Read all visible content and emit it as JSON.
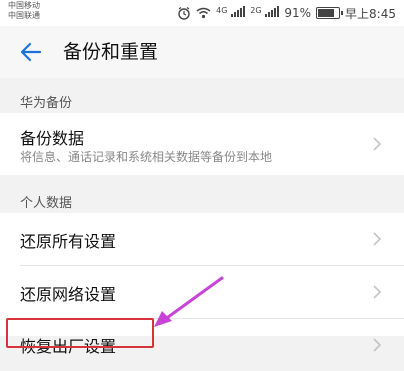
{
  "status_bar": {
    "carrier_1": "中国移动",
    "carrier_2": "中国联通",
    "network_1": "4G",
    "network_2": "2G",
    "battery": "91%",
    "battery_level": 0.91,
    "time": "早上8:45"
  },
  "header": {
    "title": "备份和重置"
  },
  "sections": [
    {
      "header": "华为备份",
      "items": [
        {
          "title": "备份数据",
          "subtitle": "将信息、通话记录和系统相关数据等备份到本地"
        }
      ]
    },
    {
      "header": "个人数据",
      "items": [
        {
          "title": "还原所有设置"
        },
        {
          "title": "还原网络设置"
        },
        {
          "title": "恢复出厂设置"
        }
      ]
    }
  ],
  "colors": {
    "accent": "#1a73d9",
    "highlight": "#d8333a",
    "arrow": "#c745d6"
  }
}
